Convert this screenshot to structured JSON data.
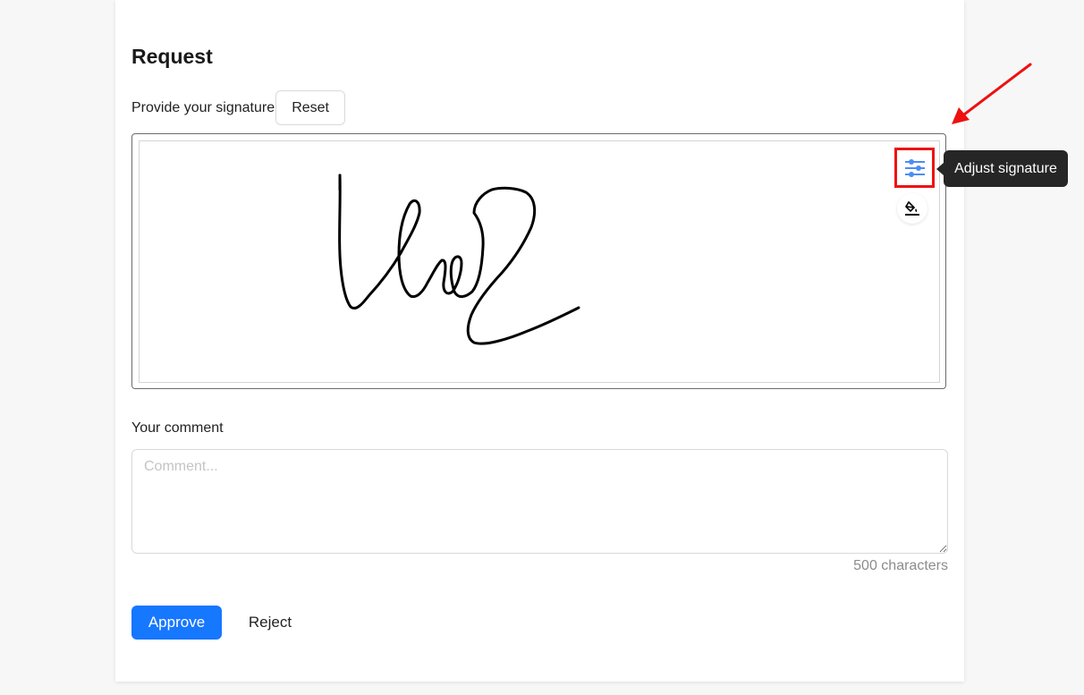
{
  "request": {
    "title": "Request"
  },
  "signature": {
    "label": "Provide your signature",
    "reset_label": "Reset",
    "tooltip": "Adjust signature",
    "adjust_icon": "sliders-icon",
    "fill_icon": "paint-bucket-icon"
  },
  "comment": {
    "label": "Your comment",
    "placeholder": "Comment...",
    "value": "",
    "char_count": "500 characters"
  },
  "actions": {
    "approve_label": "Approve",
    "reject_label": "Reject"
  },
  "colors": {
    "primary": "#1677ff",
    "highlight": "#ee1111",
    "tooltip_bg": "#262626"
  }
}
